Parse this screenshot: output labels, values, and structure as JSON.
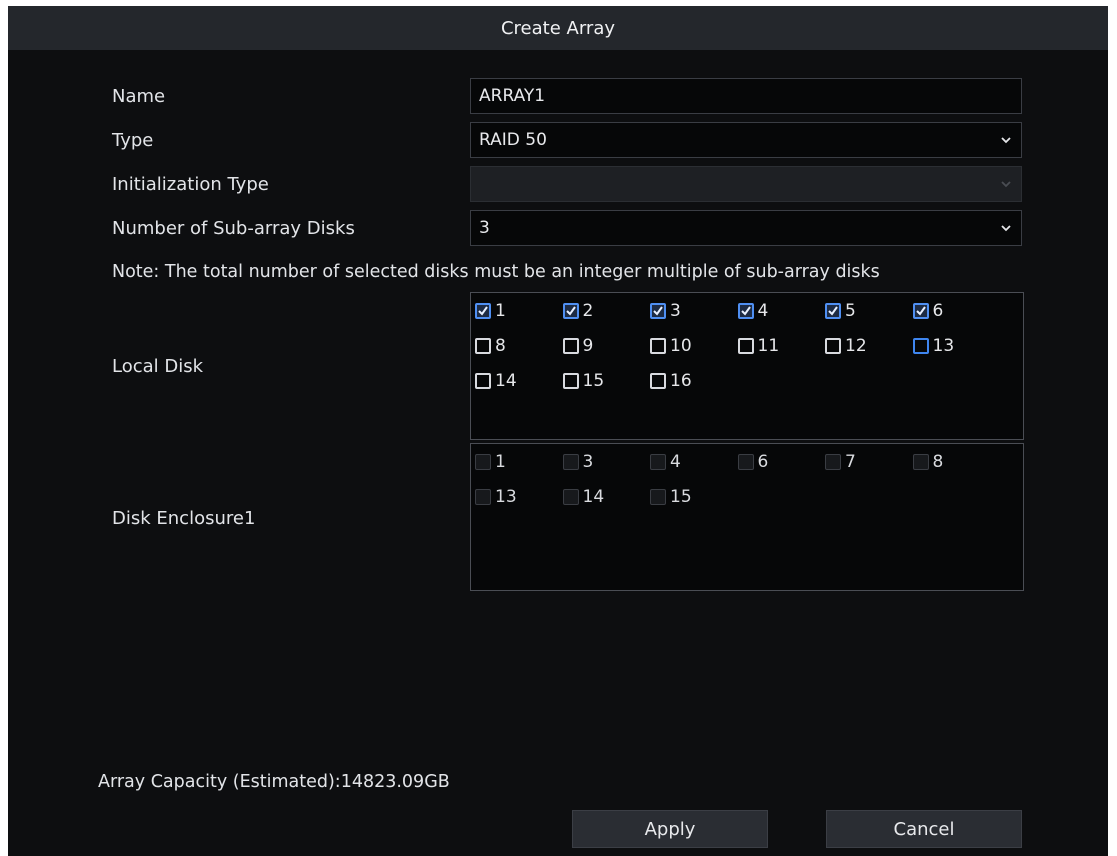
{
  "dialog": {
    "title": "Create Array"
  },
  "form": {
    "name_label": "Name",
    "name_value": "ARRAY1",
    "type_label": "Type",
    "type_value": "RAID 50",
    "init_label": "Initialization Type",
    "init_value": "",
    "subarray_label": "Number of Sub-array Disks",
    "subarray_value": "3"
  },
  "note": "Note: The total number of selected disks must be an integer multiple of sub-array disks",
  "local_disk": {
    "label": "Local Disk",
    "disks": [
      {
        "num": "1",
        "checked": true
      },
      {
        "num": "2",
        "checked": true
      },
      {
        "num": "3",
        "checked": true
      },
      {
        "num": "4",
        "checked": true
      },
      {
        "num": "5",
        "checked": true
      },
      {
        "num": "6",
        "checked": true
      },
      {
        "num": "8",
        "checked": false
      },
      {
        "num": "9",
        "checked": false
      },
      {
        "num": "10",
        "checked": false
      },
      {
        "num": "11",
        "checked": false
      },
      {
        "num": "12",
        "checked": false
      },
      {
        "num": "13",
        "checked": false,
        "focused": true
      },
      {
        "num": "14",
        "checked": false
      },
      {
        "num": "15",
        "checked": false
      },
      {
        "num": "16",
        "checked": false
      }
    ]
  },
  "enclosure": {
    "label": "Disk Enclosure1",
    "disks": [
      {
        "num": "1"
      },
      {
        "num": "3"
      },
      {
        "num": "4"
      },
      {
        "num": "6"
      },
      {
        "num": "7"
      },
      {
        "num": "8"
      },
      {
        "num": "13"
      },
      {
        "num": "14"
      },
      {
        "num": "15"
      }
    ]
  },
  "capacity": "Array Capacity (Estimated):14823.09GB",
  "buttons": {
    "apply": "Apply",
    "cancel": "Cancel"
  }
}
